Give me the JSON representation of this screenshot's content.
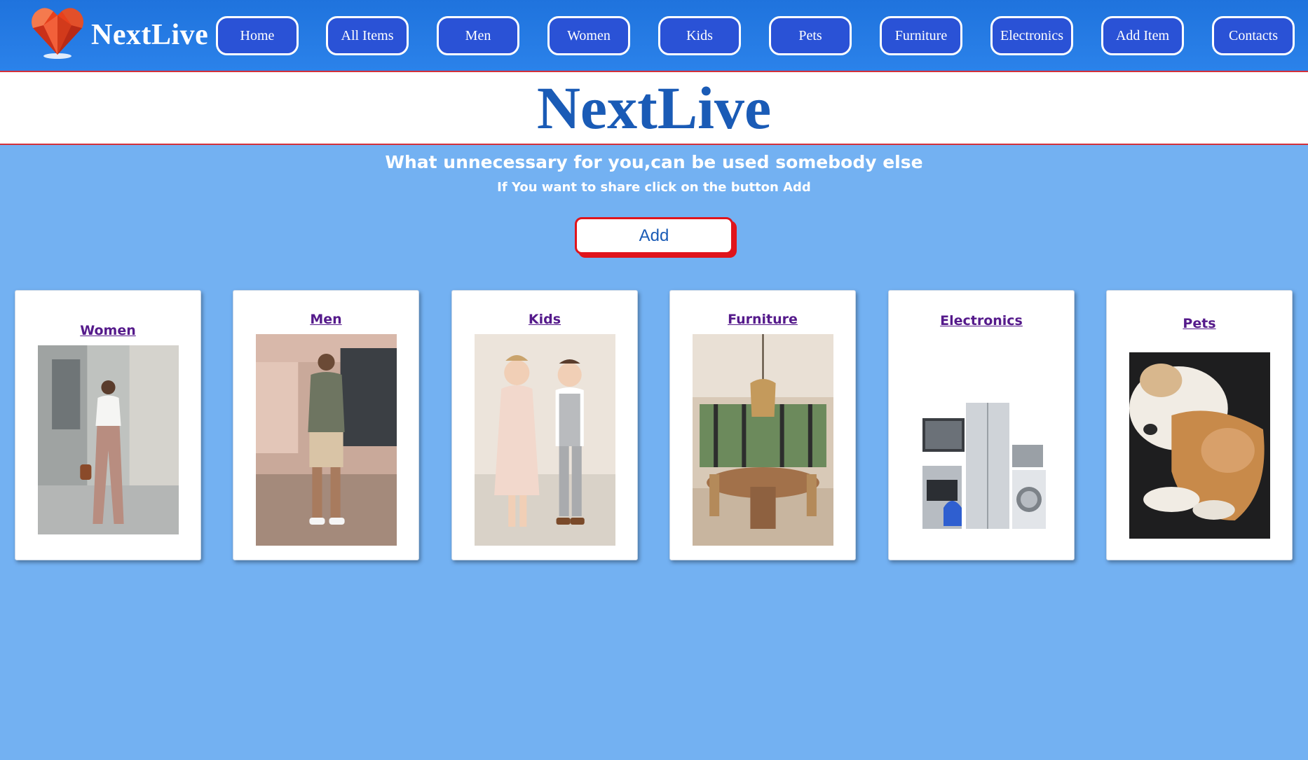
{
  "nav": {
    "brand": "NextLive",
    "items": [
      {
        "label": "Home"
      },
      {
        "label": "All Items"
      },
      {
        "label": "Men"
      },
      {
        "label": "Women"
      },
      {
        "label": "Kids"
      },
      {
        "label": "Pets"
      },
      {
        "label": "Furniture"
      },
      {
        "label": "Electronics"
      },
      {
        "label": "Add Item"
      },
      {
        "label": "Contacts"
      }
    ]
  },
  "hero": {
    "title": "NextLive"
  },
  "intro": {
    "tagline": "What unnecessary for you,can be used somebody else",
    "subtag": "If You want to share click on the button Add",
    "add_label": "Add"
  },
  "categories": [
    {
      "label": "Women",
      "image": "woman-fashion-photo"
    },
    {
      "label": "Men",
      "image": "man-fashion-photo"
    },
    {
      "label": "Kids",
      "image": "kids-photo"
    },
    {
      "label": "Furniture",
      "image": "dining-room-photo"
    },
    {
      "label": "Electronics",
      "image": "appliances-photo"
    },
    {
      "label": "Pets",
      "image": "dog-and-cat-photo"
    }
  ],
  "colors": {
    "navbar": "#1f73dd",
    "nav_button": "#2a52d6",
    "page_background": "#73b1f2",
    "hero_title": "#1a5bb6",
    "accent_red": "#e0141c",
    "link": "#551a8b"
  }
}
